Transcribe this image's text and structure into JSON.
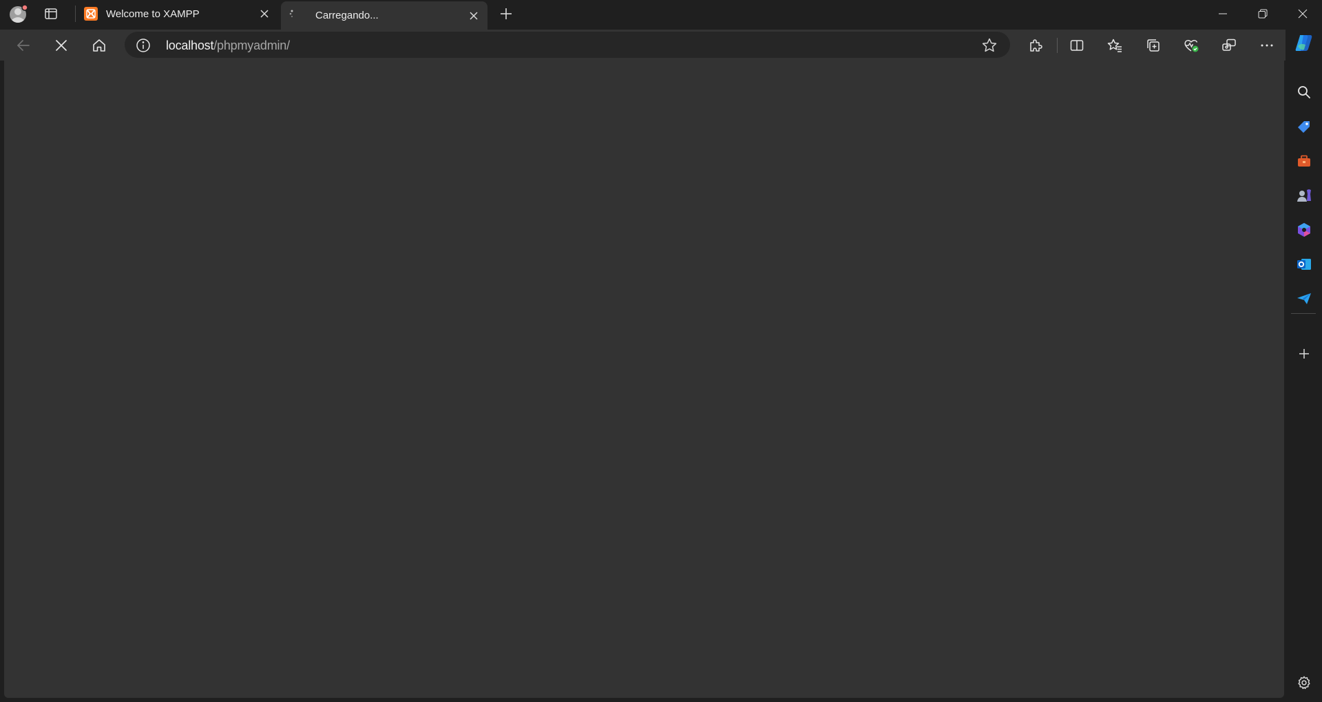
{
  "tabs": [
    {
      "title": "Welcome to XAMPP",
      "favicon": "xampp-icon",
      "active": false
    },
    {
      "title": "Carregando...",
      "favicon": "loading-spinner-icon",
      "active": true
    }
  ],
  "address_bar": {
    "host": "localhost",
    "path": "/phpmyadmin/"
  },
  "colors": {
    "frame": "#1f1f1f",
    "toolbar": "#333333",
    "omnibox": "#262626",
    "xampp_orange": "#fb7a24"
  },
  "sidebar_icons": [
    "copilot-icon",
    "search-icon",
    "shopping-icon",
    "tools-icon",
    "games-icon",
    "m365-icon",
    "outlook-icon",
    "drop-icon",
    "add-icon",
    "settings-icon"
  ]
}
